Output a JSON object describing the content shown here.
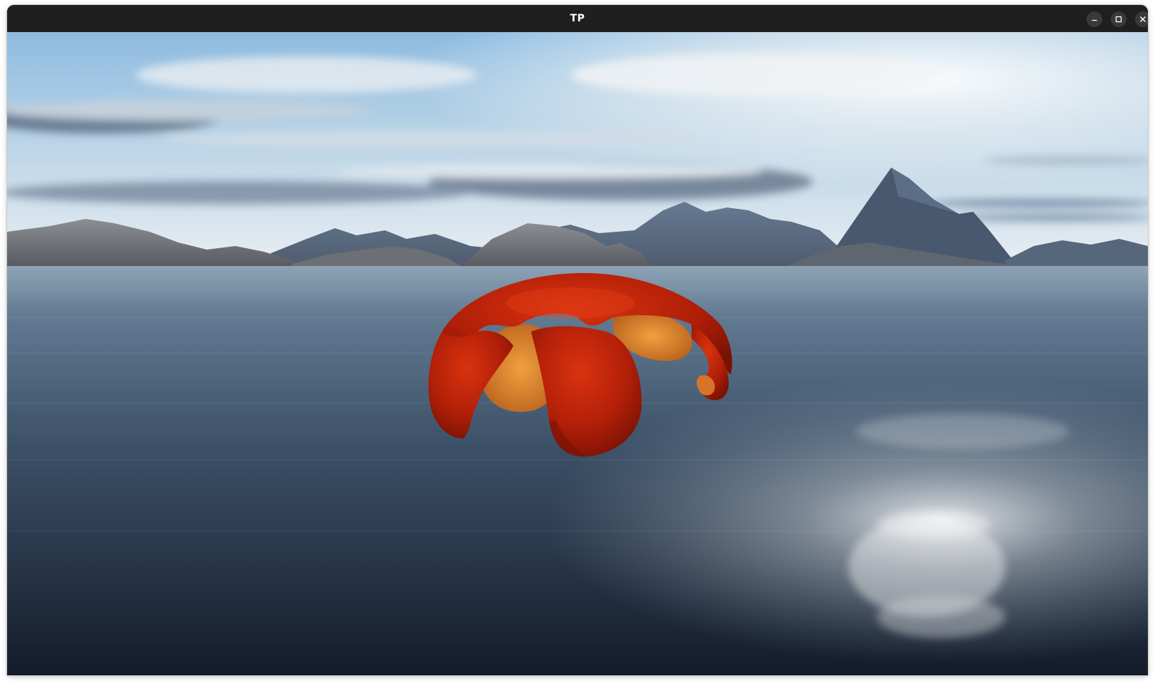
{
  "window": {
    "title": "TP",
    "controls": {
      "minimize_icon": "minimize-icon",
      "maximize_icon": "maximize-icon",
      "close_icon": "close-icon"
    }
  },
  "scene": {
    "sky_top": "#7fb3d9",
    "sky_horizon": "#e6eef4",
    "water_near": "#1b2535",
    "water_far": "#8fa6bb",
    "peel_color": "#c0260b",
    "flesh_color": "#e2862a"
  }
}
